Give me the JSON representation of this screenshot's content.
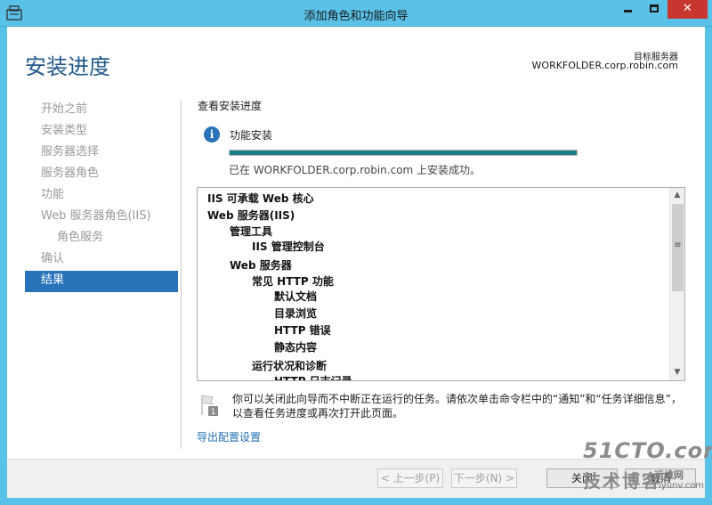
{
  "window": {
    "title": "添加角色和功能向导",
    "controls": {
      "minimize": "",
      "maximize": "",
      "close": "✕"
    }
  },
  "header": {
    "page_title": "安装进度",
    "target_label": "目标服务器",
    "target_value": "WORKFOLDER.corp.robin.com"
  },
  "sidebar": {
    "items": [
      {
        "label": "开始之前",
        "state": "disabled"
      },
      {
        "label": "安装类型",
        "state": "disabled"
      },
      {
        "label": "服务器选择",
        "state": "disabled"
      },
      {
        "label": "服务器角色",
        "state": "disabled"
      },
      {
        "label": "功能",
        "state": "disabled"
      },
      {
        "label": "Web 服务器角色(IIS)",
        "state": "disabled"
      },
      {
        "label": "角色服务",
        "state": "disabled"
      },
      {
        "label": "确认",
        "state": "disabled"
      },
      {
        "label": "结果",
        "state": "active"
      }
    ]
  },
  "main": {
    "section_heading": "查看安装进度",
    "status_label": "功能安装",
    "progress": 1.0,
    "success_msg": "已在 WORKFOLDER.corp.robin.com 上安装成功。",
    "features": [
      {
        "label": "IIS 可承载 Web 核心",
        "level": 0
      },
      {
        "label": "Web 服务器(IIS)",
        "level": 0
      },
      {
        "label": "管理工具",
        "level": 1
      },
      {
        "label": "IIS 管理控制台",
        "level": 2
      },
      {
        "label": "Web 服务器",
        "level": 1
      },
      {
        "label": "常见 HTTP 功能",
        "level": 2
      },
      {
        "label": "默认文档",
        "level": 3
      },
      {
        "label": "目录浏览",
        "level": 3
      },
      {
        "label": "HTTP 错误",
        "level": 3
      },
      {
        "label": "静态内容",
        "level": 3
      },
      {
        "label": "运行状况和诊断",
        "level": 2
      },
      {
        "label": "HTTP 日志记录",
        "level": 3
      }
    ],
    "notice_badge": "1",
    "notice": "你可以关闭此向导而不中断正在运行的任务。请依次单击命令栏中的“通知”和“任务详细信息”，以查看任务进度或再次打开此页面。",
    "export_link": "导出配置设置"
  },
  "footer": {
    "prev": "< 上一步(P)",
    "next": "下一步(N) >",
    "close": "关闭",
    "cancel": "取消"
  },
  "watermark": {
    "line1": "51CTO.com",
    "line2": "技术博客",
    "line3": "运维网",
    "line4": "iyunv.com"
  }
}
